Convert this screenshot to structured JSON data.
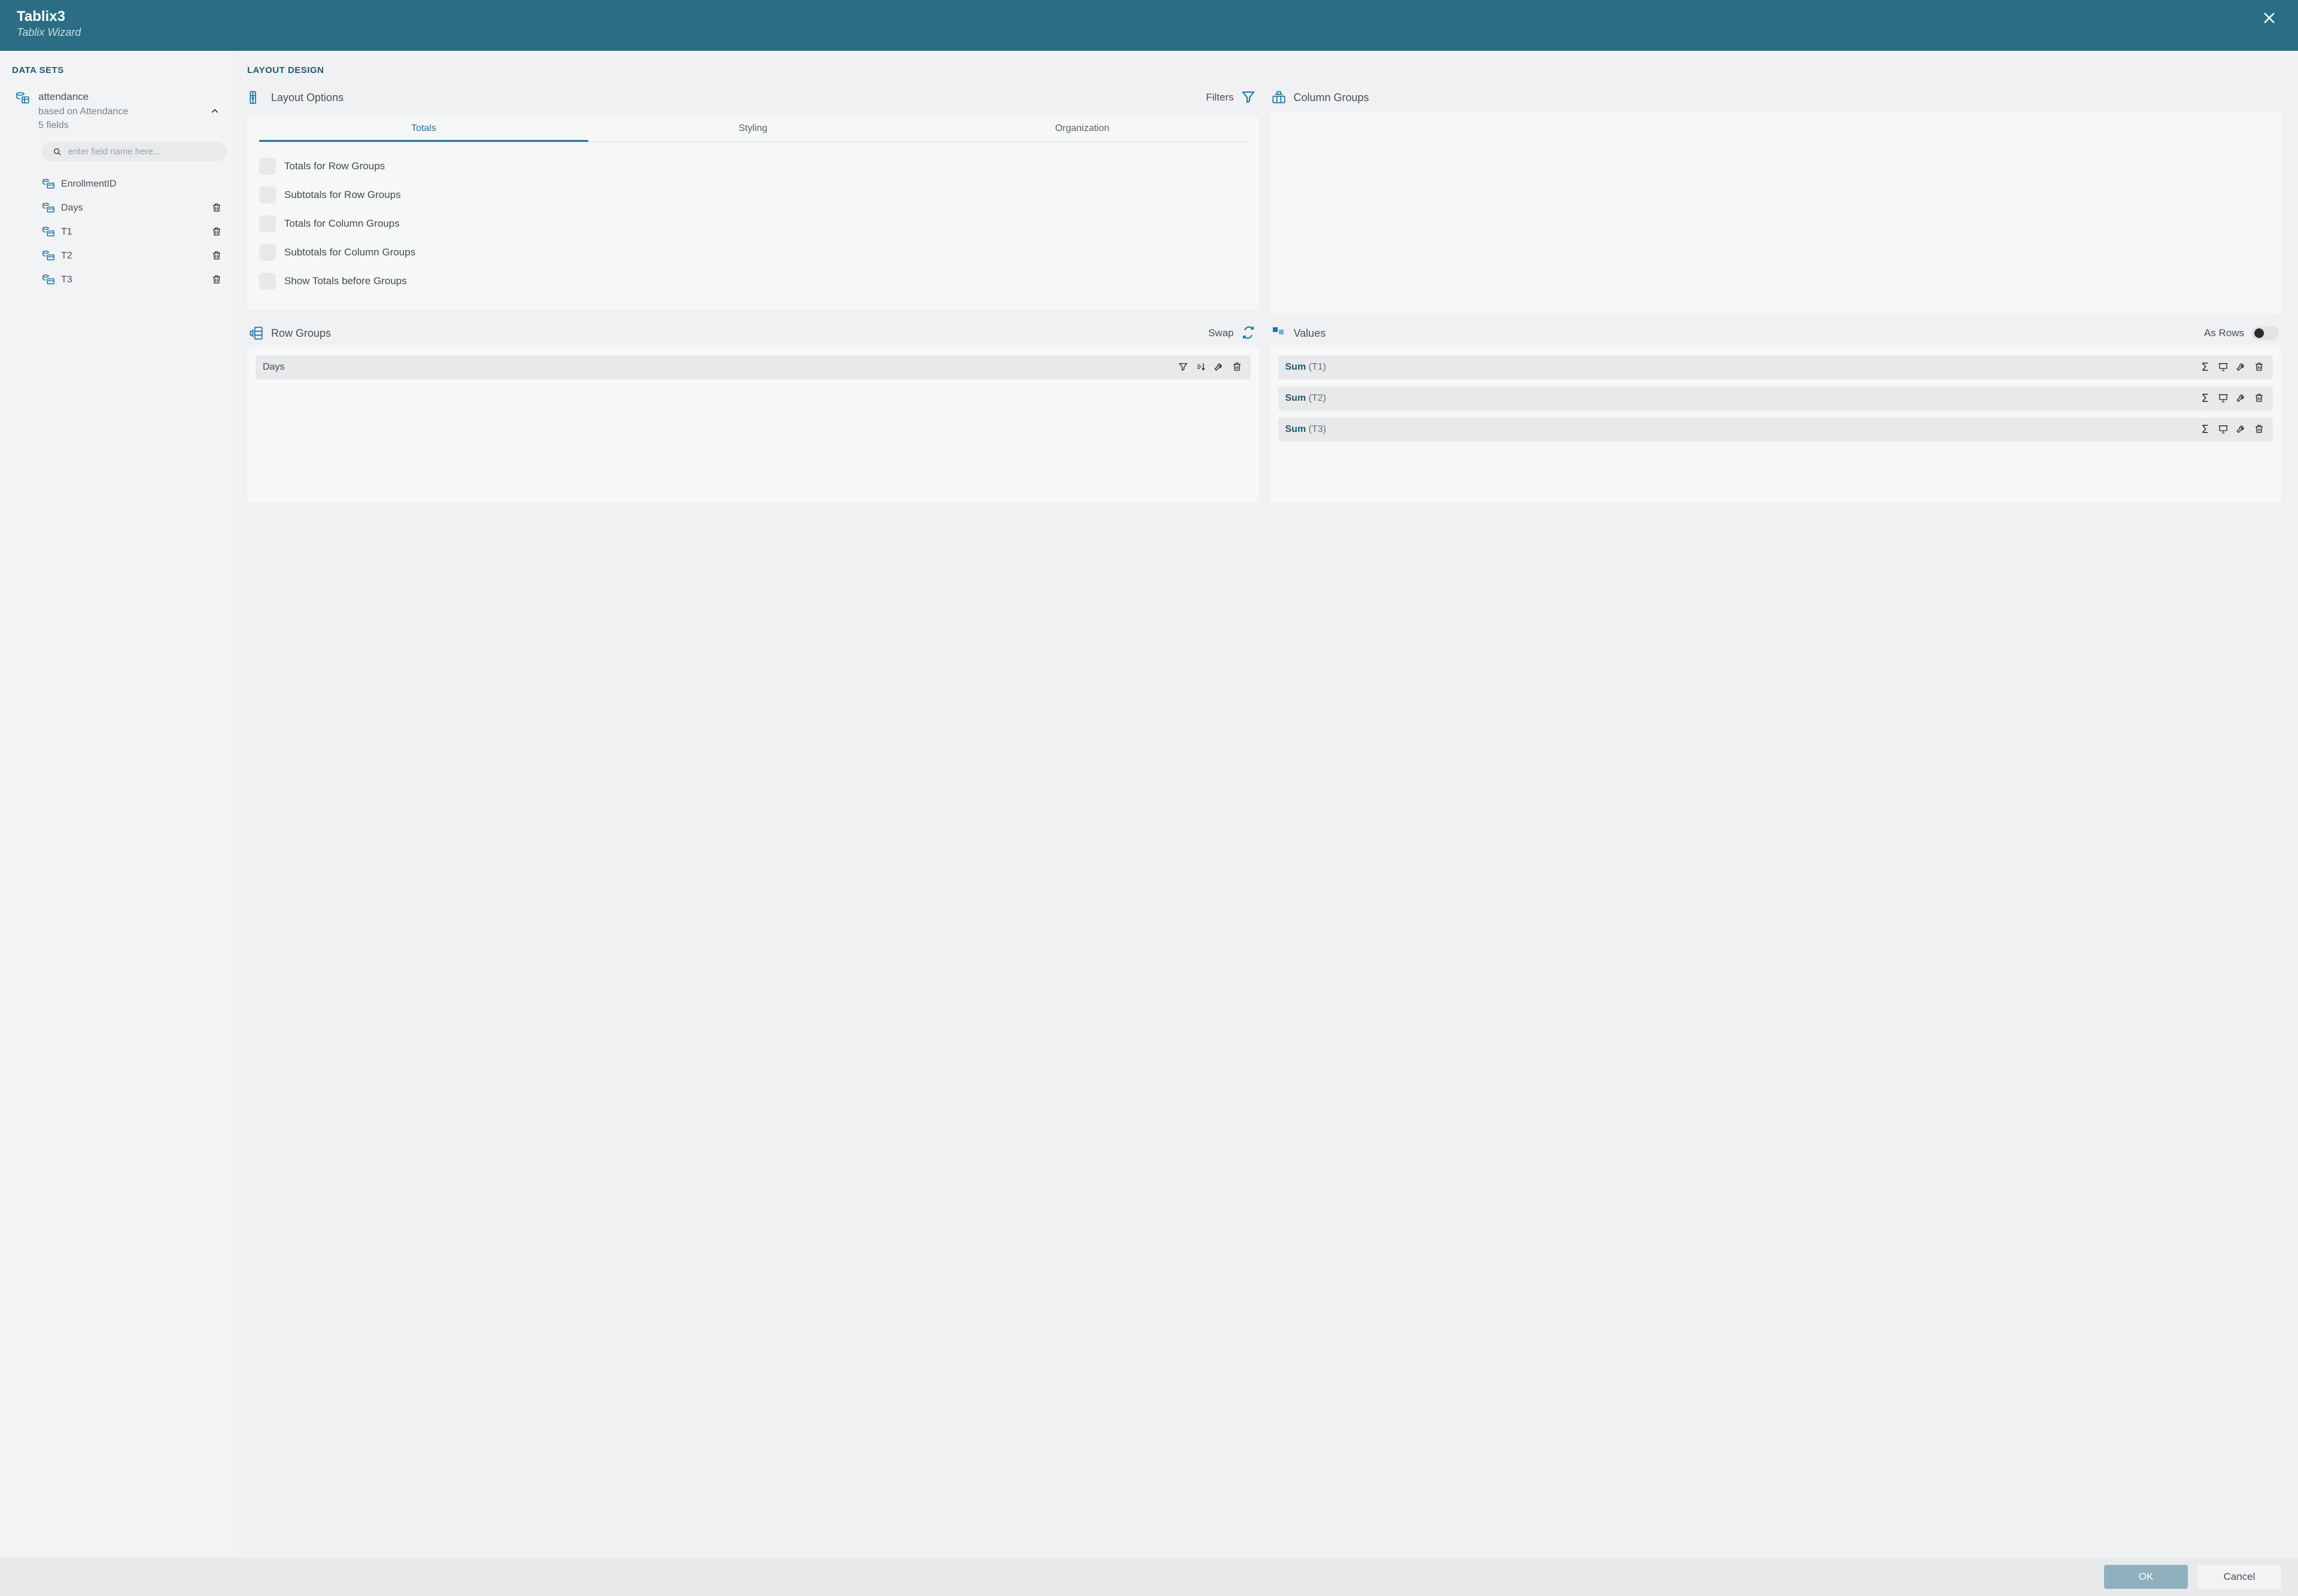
{
  "header": {
    "title": "Tablix3",
    "subtitle": "Tablix Wizard"
  },
  "sidebar": {
    "section_title": "DATA SETS",
    "dataset": {
      "name": "attendance",
      "based_on": "based on Attendance",
      "field_count": "5 fields"
    },
    "search_placeholder": "enter field name here...",
    "fields": [
      {
        "name": "EnrollmentID",
        "deletable": false
      },
      {
        "name": "Days",
        "deletable": true
      },
      {
        "name": "T1",
        "deletable": true
      },
      {
        "name": "T2",
        "deletable": true
      },
      {
        "name": "T3",
        "deletable": true
      }
    ]
  },
  "main": {
    "section_title": "LAYOUT DESIGN",
    "layout_options": {
      "title": "Layout Options",
      "filters_label": "Filters",
      "tabs": [
        "Totals",
        "Styling",
        "Organization"
      ],
      "active_tab": 0,
      "checks": [
        "Totals for Row Groups",
        "Subtotals for Row Groups",
        "Totals for Column Groups",
        "Subtotals for Column Groups",
        "Show Totals before Groups"
      ]
    },
    "column_groups": {
      "title": "Column Groups"
    },
    "row_groups": {
      "title": "Row Groups",
      "swap_label": "Swap",
      "items": [
        {
          "label": "Days"
        }
      ]
    },
    "values": {
      "title": "Values",
      "as_rows_label": "As Rows",
      "items": [
        {
          "agg": "Sum",
          "arg": "(T1)"
        },
        {
          "agg": "Sum",
          "arg": "(T2)"
        },
        {
          "agg": "Sum",
          "arg": "(T3)"
        }
      ]
    }
  },
  "footer": {
    "ok": "OK",
    "cancel": "Cancel"
  }
}
